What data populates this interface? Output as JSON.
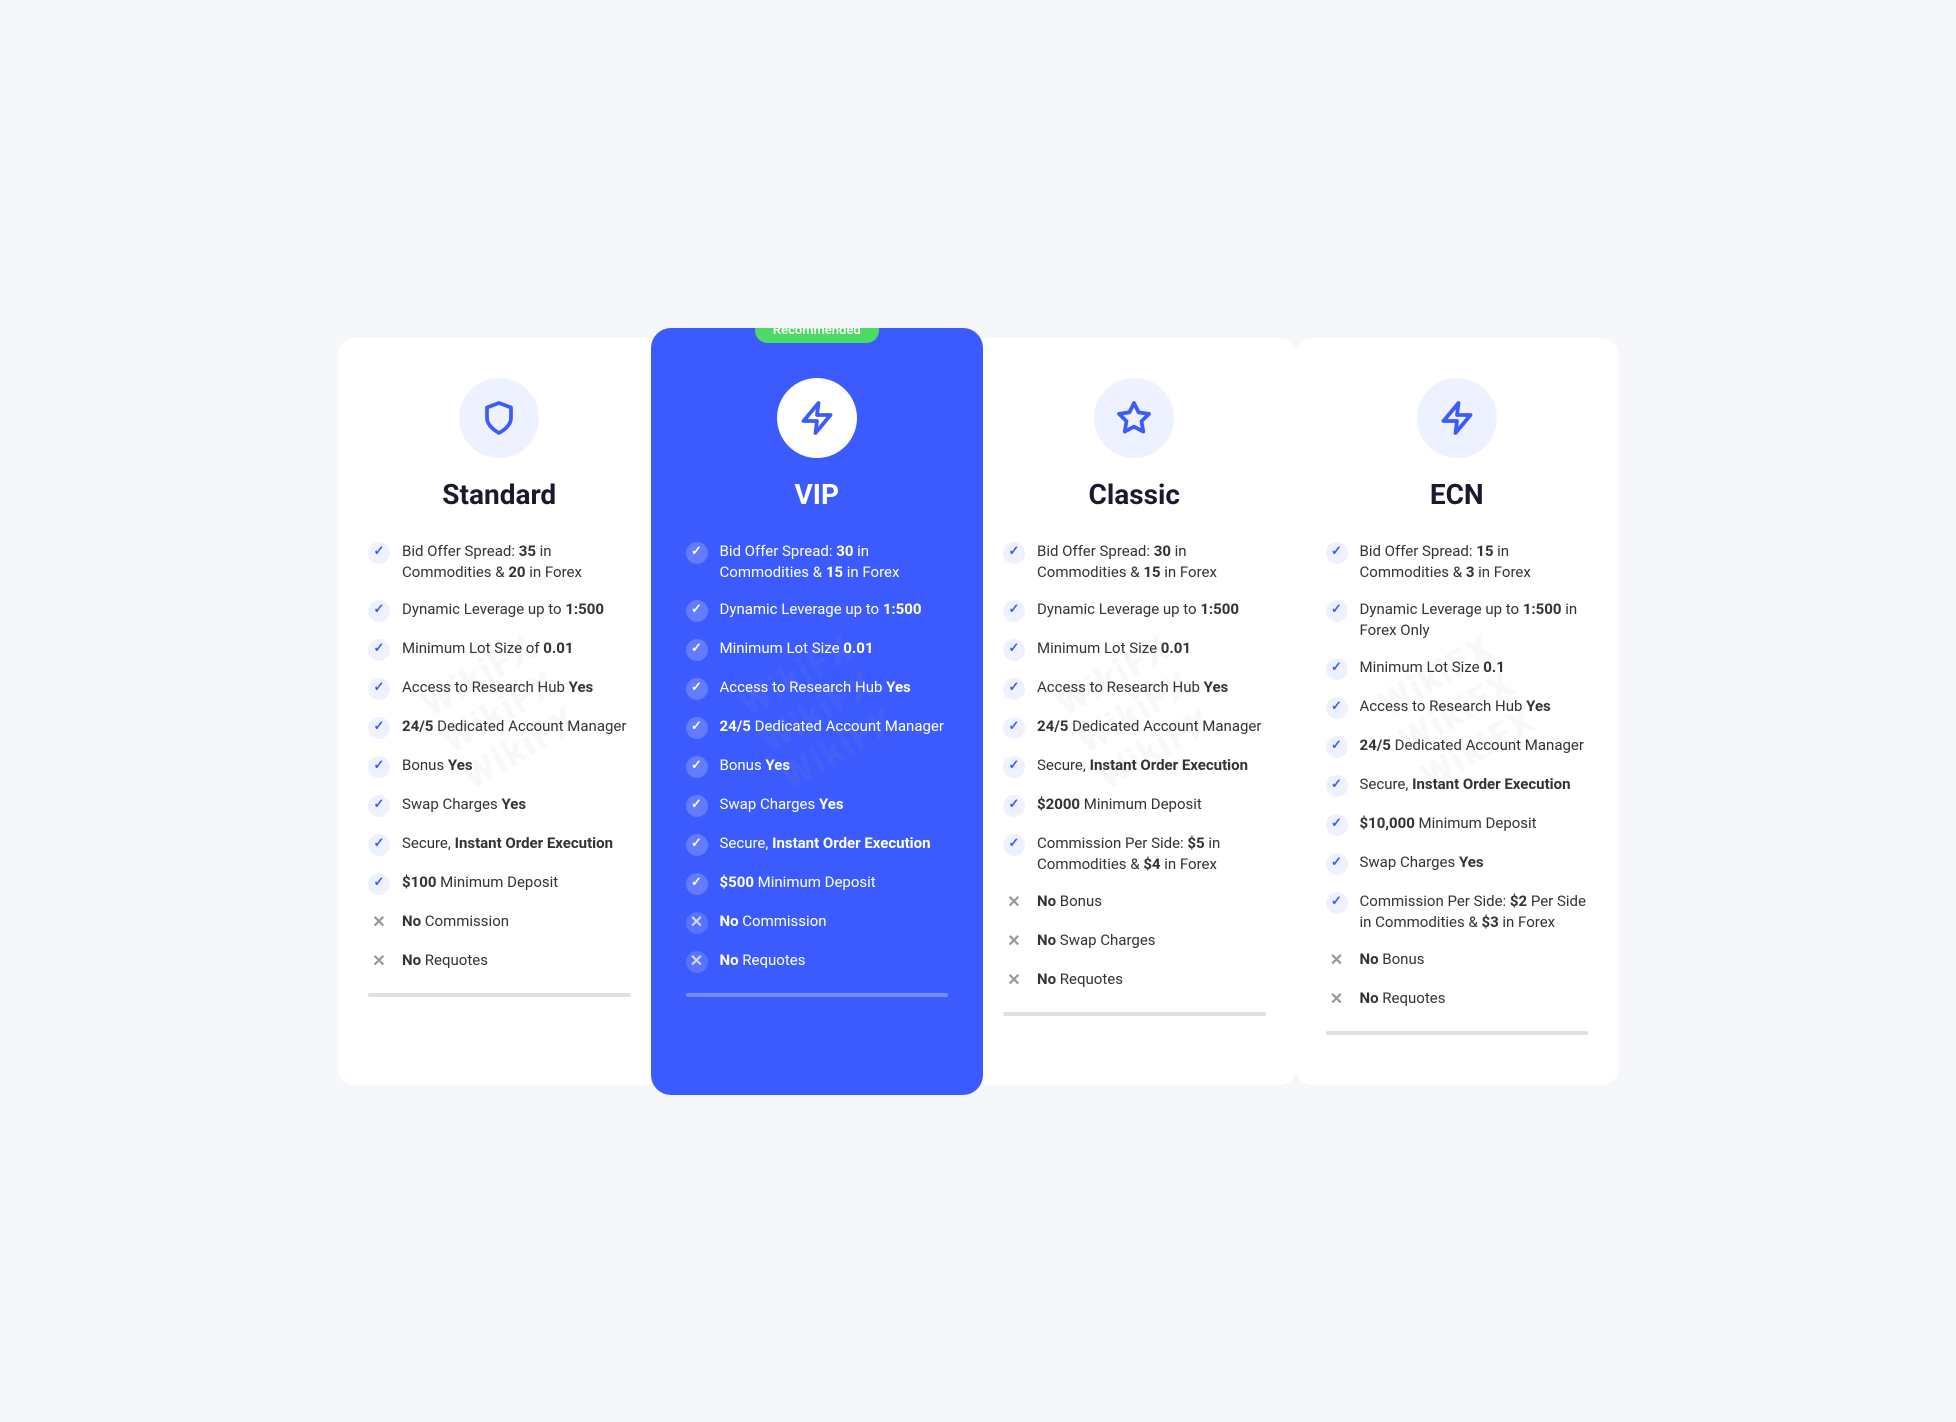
{
  "cards": [
    {
      "id": "standard",
      "title": "Standard",
      "recommended": false,
      "icon": "🛡",
      "features": [
        {
          "check": true,
          "text": "Bid Offer Spread: <strong>35</strong> in Commodities & <strong>20</strong> in Forex"
        },
        {
          "check": true,
          "text": "Dynamic Leverage up to <strong>1:500</strong>"
        },
        {
          "check": true,
          "text": "Minimum Lot Size of <strong>0.01</strong>"
        },
        {
          "check": true,
          "text": "Access to Research Hub <strong>Yes</strong>"
        },
        {
          "check": true,
          "text": "<strong>24/5</strong> Dedicated Account Manager"
        },
        {
          "check": true,
          "text": "Bonus <strong>Yes</strong>"
        },
        {
          "check": true,
          "text": "Swap Charges <strong>Yes</strong>"
        },
        {
          "check": true,
          "text": "Secure, <strong>Instant Order Execution</strong>"
        },
        {
          "check": true,
          "text": "<strong>$100</strong> Minimum Deposit"
        },
        {
          "check": false,
          "text": "<strong>No</strong> Commission"
        },
        {
          "check": false,
          "text": "<strong>No</strong> Requotes"
        }
      ]
    },
    {
      "id": "vip",
      "title": "VIP",
      "recommended": true,
      "icon": "⚡",
      "features": [
        {
          "check": true,
          "text": "Bid Offer Spread: <strong>30</strong> in Commodities & <strong>15</strong> in Forex"
        },
        {
          "check": true,
          "text": "Dynamic Leverage up to <strong>1:500</strong>"
        },
        {
          "check": true,
          "text": "Minimum Lot Size <strong>0.01</strong>"
        },
        {
          "check": true,
          "text": "Access to Research Hub <strong>Yes</strong>"
        },
        {
          "check": true,
          "text": "<strong>24/5</strong> Dedicated Account Manager"
        },
        {
          "check": true,
          "text": "Bonus <strong>Yes</strong>"
        },
        {
          "check": true,
          "text": "Swap Charges <strong>Yes</strong>"
        },
        {
          "check": true,
          "text": "Secure, <strong>Instant Order Execution</strong>"
        },
        {
          "check": true,
          "text": "<strong>$500</strong> Minimum Deposit"
        },
        {
          "check": false,
          "text": "<strong>No</strong> Commission"
        },
        {
          "check": false,
          "text": "<strong>No</strong> Requotes"
        }
      ]
    },
    {
      "id": "classic",
      "title": "Classic",
      "recommended": false,
      "icon": "⭐",
      "features": [
        {
          "check": true,
          "text": "Bid Offer Spread: <strong>30</strong> in Commodities & <strong>15</strong> in Forex"
        },
        {
          "check": true,
          "text": "Dynamic Leverage up to <strong>1:500</strong>"
        },
        {
          "check": true,
          "text": "Minimum Lot Size <strong>0.01</strong>"
        },
        {
          "check": true,
          "text": "Access to Research Hub <strong>Yes</strong>"
        },
        {
          "check": true,
          "text": "<strong>24/5</strong> Dedicated Account Manager"
        },
        {
          "check": true,
          "text": "Secure, <strong>Instant Order Execution</strong>"
        },
        {
          "check": true,
          "text": "<strong>$2000</strong> Minimum Deposit"
        },
        {
          "check": true,
          "text": "Commission Per Side: <strong>$5</strong> in Commodities & <strong>$4</strong> in Forex"
        },
        {
          "check": false,
          "text": "<strong>No</strong> Bonus"
        },
        {
          "check": false,
          "text": "<strong>No</strong> Swap Charges"
        },
        {
          "check": false,
          "text": "<strong>No</strong> Requotes"
        }
      ]
    },
    {
      "id": "ecn",
      "title": "ECN",
      "recommended": false,
      "icon": "⚡",
      "features": [
        {
          "check": true,
          "text": "Bid Offer Spread: <strong>15</strong> in Commodities & <strong>3</strong> in Forex"
        },
        {
          "check": true,
          "text": "Dynamic Leverage up to <strong>1:500</strong> in Forex Only"
        },
        {
          "check": true,
          "text": "Minimum Lot Size <strong>0.1</strong>"
        },
        {
          "check": true,
          "text": "Access to Research Hub <strong>Yes</strong>"
        },
        {
          "check": true,
          "text": "<strong>24/5</strong> Dedicated Account Manager"
        },
        {
          "check": true,
          "text": "Secure, <strong>Instant Order Execution</strong>"
        },
        {
          "check": true,
          "text": "<strong>$10,000</strong> Minimum Deposit"
        },
        {
          "check": true,
          "text": "Swap Charges <strong>Yes</strong>"
        },
        {
          "check": true,
          "text": "Commission Per Side: <strong>$2</strong> Per Side in Commodities & <strong>$3</strong> in Forex"
        },
        {
          "check": false,
          "text": "<strong>No</strong> Bonus"
        },
        {
          "check": false,
          "text": "<strong>No</strong> Requotes"
        }
      ]
    }
  ],
  "recommended_label": "Recommended",
  "watermark_text": "WikiFX"
}
